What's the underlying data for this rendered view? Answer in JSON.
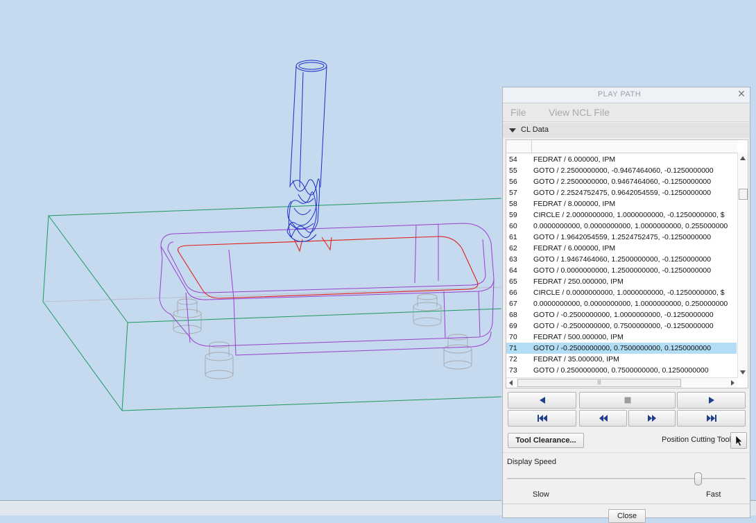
{
  "viewport": {
    "colors": {
      "background": "#c5d9ef",
      "stock": "#1a9a5f",
      "part": "#9b3fd0",
      "toolpath": "#e0201a",
      "tool": "#1a2dc8",
      "fixture": "#a8a8a8"
    }
  },
  "panel": {
    "title": "PLAY PATH",
    "close_icon": "close-icon",
    "menu": [
      "File",
      "View",
      "NCL File"
    ],
    "section_label": "CL Data",
    "rows": [
      {
        "num": "54",
        "code": "FEDRAT / 6.000000,  IPM"
      },
      {
        "num": "55",
        "code": "GOTO / 2.2500000000, -0.9467464060, -0.1250000000"
      },
      {
        "num": "56",
        "code": "GOTO / 2.2500000000, 0.9467464060, -0.1250000000"
      },
      {
        "num": "57",
        "code": "GOTO / 2.2524752475, 0.9642054559, -0.1250000000"
      },
      {
        "num": "58",
        "code": "FEDRAT / 8.000000,  IPM"
      },
      {
        "num": "59",
        "code": "CIRCLE / 2.0000000000, 1.0000000000, -0.1250000000,  $"
      },
      {
        "num": "60",
        "code": "0.0000000000, 0.0000000000, 1.0000000000,  0.255000000"
      },
      {
        "num": "61",
        "code": "GOTO / 1.9642054559, 1.2524752475, -0.1250000000"
      },
      {
        "num": "62",
        "code": "FEDRAT / 6.000000,  IPM"
      },
      {
        "num": "63",
        "code": "GOTO / 1.9467464060, 1.2500000000, -0.1250000000"
      },
      {
        "num": "64",
        "code": "GOTO / 0.0000000000, 1.2500000000, -0.1250000000"
      },
      {
        "num": "65",
        "code": "FEDRAT / 250.000000,  IPM"
      },
      {
        "num": "66",
        "code": "CIRCLE / 0.0000000000, 1.0000000000, -0.1250000000,  $"
      },
      {
        "num": "67",
        "code": "0.0000000000, 0.0000000000, 1.0000000000,  0.250000000"
      },
      {
        "num": "68",
        "code": "GOTO / -0.2500000000, 1.0000000000, -0.1250000000"
      },
      {
        "num": "69",
        "code": "GOTO / -0.2500000000, 0.7500000000, -0.1250000000"
      },
      {
        "num": "70",
        "code": "FEDRAT / 500.000000,  IPM"
      },
      {
        "num": "71",
        "code": "GOTO / -0.2500000000, 0.7500000000, 0.1250000000",
        "selected": true
      },
      {
        "num": "72",
        "code": "FEDRAT / 35.000000,  IPM"
      },
      {
        "num": "73",
        "code": "GOTO / 0.2500000000, 0.7500000000, 0.1250000000"
      }
    ],
    "selection_color": "#b3dcf5",
    "playback_icons": [
      "step-back-icon",
      "stop-icon",
      "play-icon",
      "go-to-start-icon",
      "rewind-icon",
      "fast-forward-icon",
      "go-to-end-icon"
    ],
    "tool_clearance_label": "Tool Clearance...",
    "position_tool_label": "Position Cutting Tool",
    "display_speed_label": "Display Speed",
    "speed_level": 0.8,
    "slow_label": "Slow",
    "fast_label": "Fast",
    "close_button_label": "Close"
  }
}
